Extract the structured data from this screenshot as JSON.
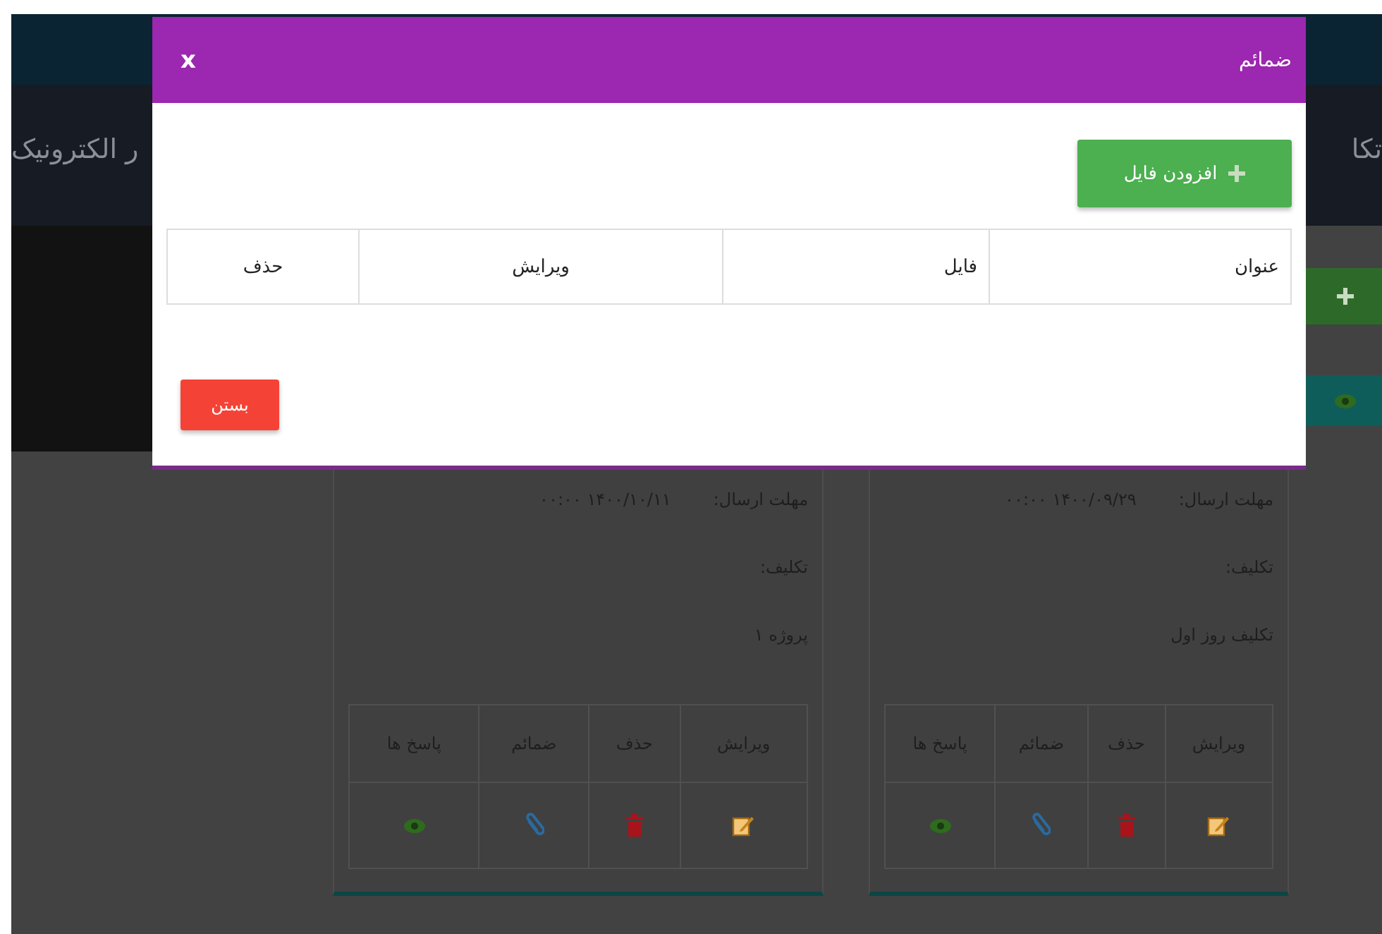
{
  "header": {
    "title_right": "تکا",
    "title_left": "ر الکترونیک"
  },
  "side_buttons": [
    {
      "kind": "add"
    },
    {
      "kind": "view"
    }
  ],
  "cards": [
    {
      "deadline_label": "مهلت ارسال:",
      "deadline": "۱۴۰۰/۰۹/۲۹ ۰۰:۰۰",
      "assignment_label": "تکلیف:",
      "title": "تکلیف روز اول",
      "actions": [
        {
          "label": "ویرایش",
          "kind": "edit"
        },
        {
          "label": "حذف",
          "kind": "delete"
        },
        {
          "label": "ضمائم",
          "kind": "attach"
        },
        {
          "label": "پاسخ ها",
          "kind": "view"
        }
      ]
    },
    {
      "deadline_label": "مهلت ارسال:",
      "deadline": "۱۴۰۰/۱۰/۱۱ ۰۰:۰۰",
      "assignment_label": "تکلیف:",
      "title": "پروژه ۱",
      "actions": [
        {
          "label": "ویرایش",
          "kind": "edit"
        },
        {
          "label": "حذف",
          "kind": "delete"
        },
        {
          "label": "ضمائم",
          "kind": "attach"
        },
        {
          "label": "پاسخ ها",
          "kind": "view"
        }
      ]
    }
  ],
  "modal": {
    "title": "ضمائم",
    "close": "x",
    "add_button": "افزودن فایل",
    "table": {
      "columns": [
        "عنوان",
        "فایل",
        "ویرایش",
        "حذف"
      ]
    },
    "close_button": "بستن"
  }
}
